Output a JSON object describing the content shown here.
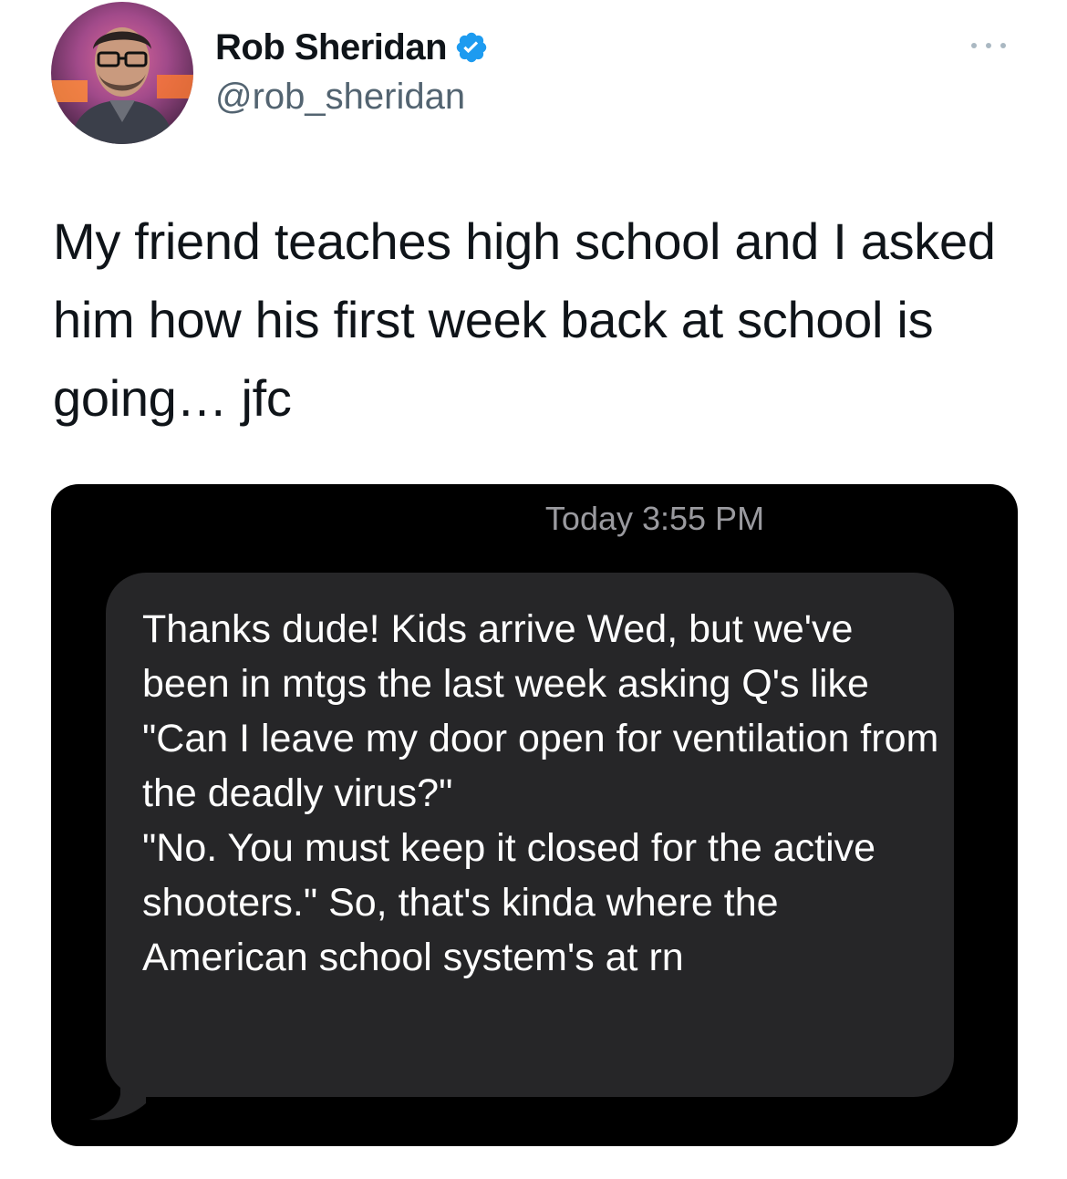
{
  "author": {
    "display_name": "Rob Sheridan",
    "handle": "@rob_sheridan",
    "verified": true,
    "avatar_icon": "avatar-photo",
    "verified_color": "#1d9bf0"
  },
  "tweet": {
    "text": "My friend teaches high school and I asked him how his first week back at school is going… jfc"
  },
  "menu": {
    "icon": "more-options-icon"
  },
  "message_screenshot": {
    "timestamp": "Today 3:55 PM",
    "message": "Thanks dude! Kids arrive Wed, but we've been in mtgs the last week asking Q's like \"Can I leave my door open for ventilation from the deadly virus?\"\n\"No. You must keep it closed for the active shooters.\" So, that's kinda where the American school system's at rn",
    "bubble_color": "#262628",
    "background_color": "#000000"
  }
}
